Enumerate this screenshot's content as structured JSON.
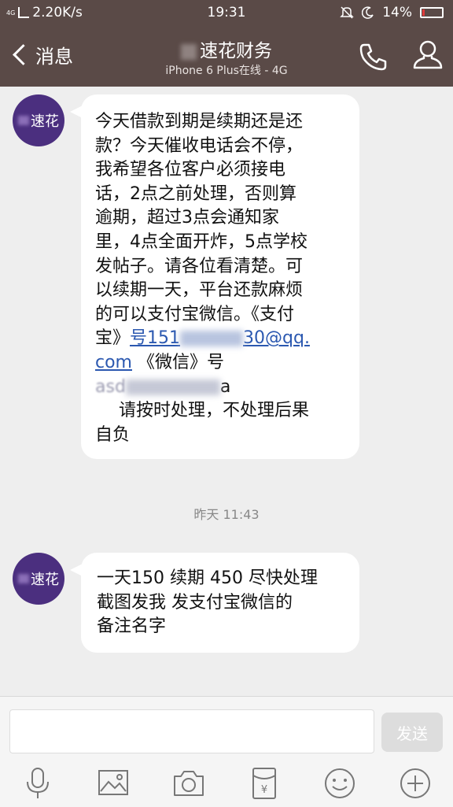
{
  "status_bar": {
    "network": "4G",
    "speed": "2.20K/s",
    "time": "19:31",
    "battery": "14%",
    "battery_level": 0.14
  },
  "header": {
    "back_label": "消息",
    "title": "速花财务",
    "subtitle": "iPhone 6 Plus在线 - 4G"
  },
  "avatar": {
    "label": "速花"
  },
  "messages": [
    {
      "lines": [
        "今天借款到期是续期还是还",
        "款？今天催收电话会不停，",
        "我希望各位客户必须接电",
        "话，2点之前处理，否则算",
        "逾期，超过3点会通知家",
        "里，4点全面开炸，5点学校",
        "发帖子。请各位看清楚。可",
        "以续期一天，平台还款麻烦",
        "的可以支付宝微信。《支付"
      ],
      "alipay_prefix": "宝》",
      "link_start": "号151",
      "link_end": "30@qq.",
      "link_domain": "com",
      "wechat_label": "《微信》号",
      "wechat_prefix": "asd",
      "wechat_suffix": "a",
      "tail_lines": [
        "请按时处理，不处理后果",
        "自负"
      ]
    },
    {
      "lines": [
        "一天150 续期 450 尽快处理",
        "截图发我  发支付宝微信的",
        "备注名字"
      ]
    }
  ],
  "timestamp": "昨天 11:43",
  "input": {
    "placeholder": "",
    "send_label": "发送"
  },
  "toolbar_icons": [
    "microphone-icon",
    "image-icon",
    "camera-icon",
    "red-envelope-icon",
    "emoji-icon",
    "plus-icon"
  ],
  "colors": {
    "header_bg": "#5a4a47",
    "avatar_bg": "#4b2f7f",
    "link": "#2b58b0"
  }
}
